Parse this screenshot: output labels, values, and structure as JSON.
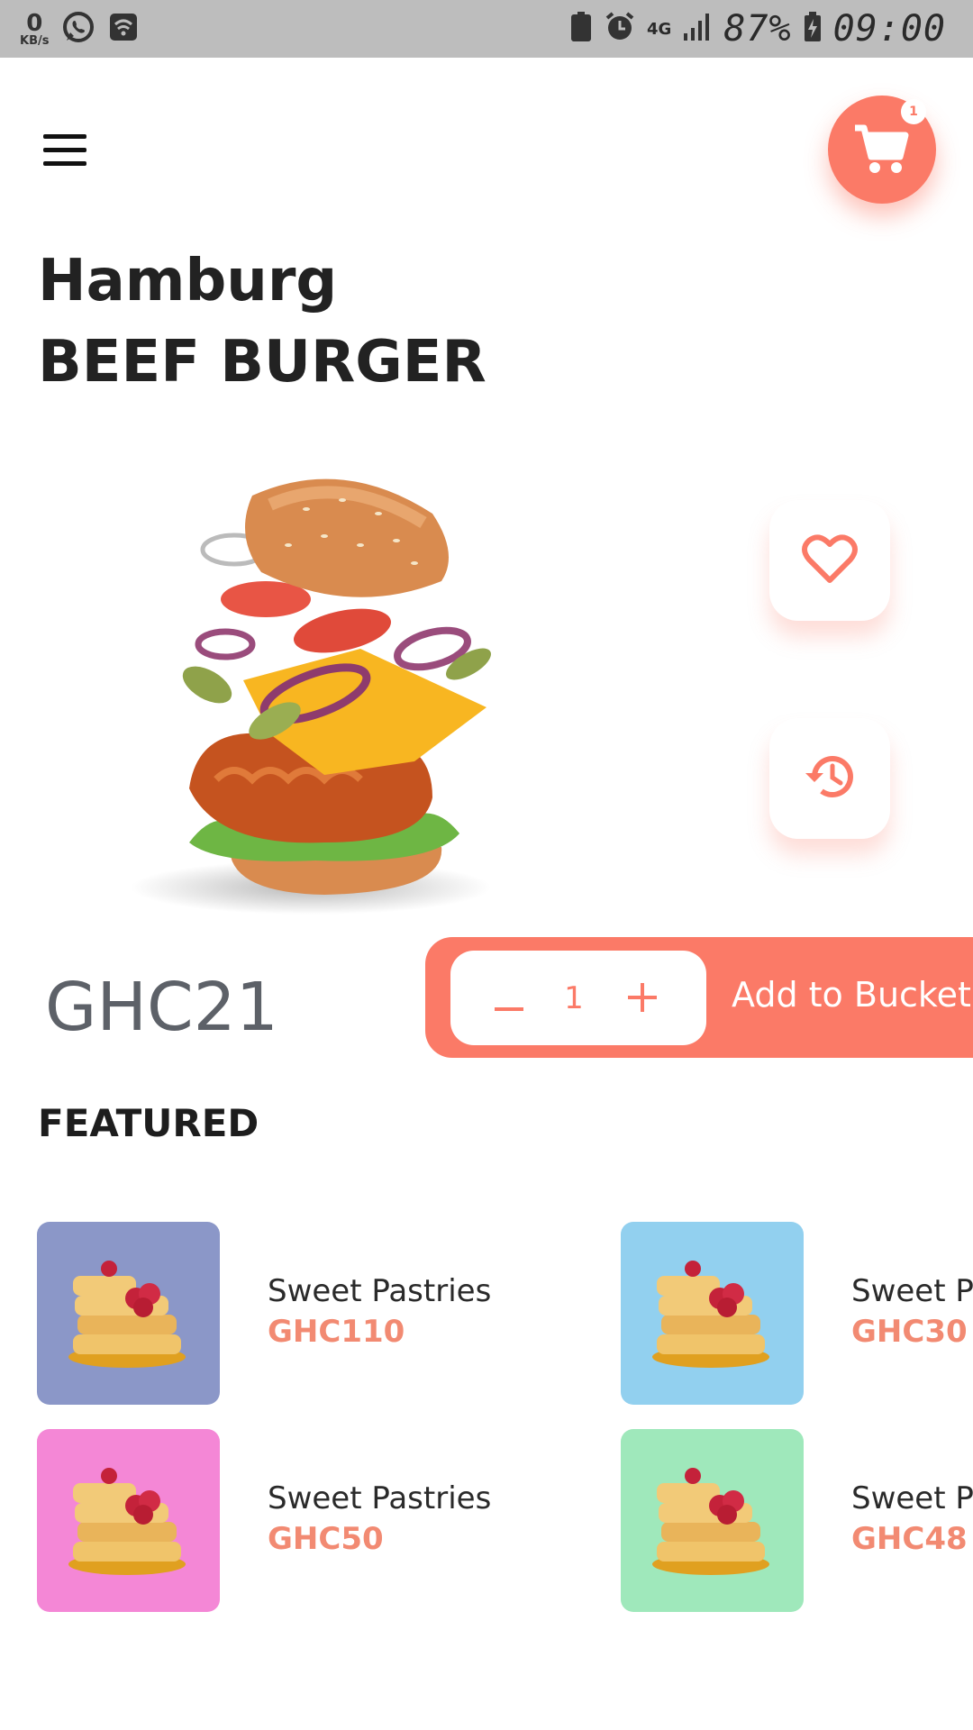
{
  "status_bar": {
    "net_speed_value": "0",
    "net_speed_unit": "KB/s",
    "network": "4G",
    "battery": "87%",
    "time": "09:00"
  },
  "header": {
    "menu_icon": "hamburger-menu-icon",
    "cart_icon": "shopping-cart-icon",
    "cart_count": "1"
  },
  "product": {
    "brand": "Hamburg",
    "name": "BEEF BURGER",
    "price": "GHC21",
    "quantity": "1",
    "add_label": "Add to Bucket"
  },
  "actions": {
    "favorite_icon": "heart-icon",
    "history_icon": "history-icon"
  },
  "featured": {
    "title": "FEATURED",
    "items": [
      {
        "name": "Sweet Pastries",
        "price": "GHC110",
        "color": "#8b97c8"
      },
      {
        "name": "Sweet Pa",
        "price": "GHC30",
        "color": "#92d0ef"
      },
      {
        "name": "Sweet Pastries",
        "price": "GHC50",
        "color": "#f487d6"
      },
      {
        "name": "Sweet Pa",
        "price": "GHC48",
        "color": "#9fe8bb"
      }
    ]
  },
  "colors": {
    "accent": "#fb7a67",
    "price_text": "#f28a72"
  }
}
